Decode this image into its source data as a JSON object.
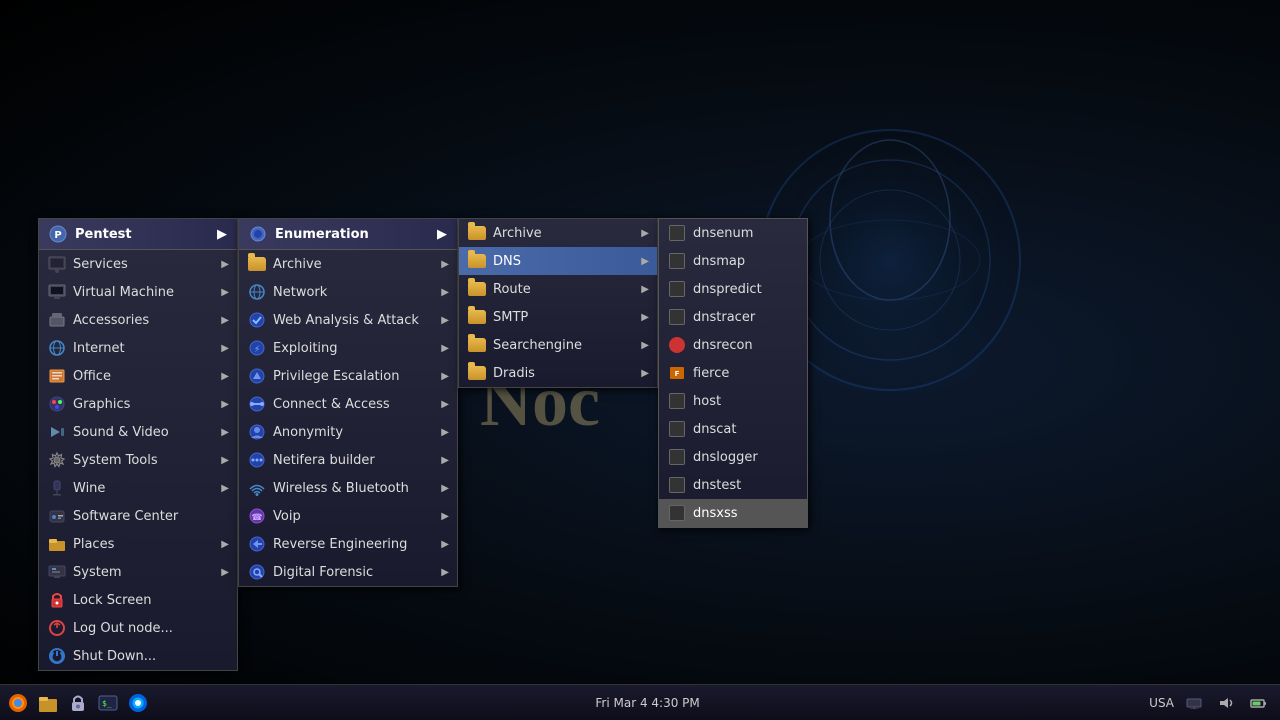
{
  "desktop": {
    "bg_text": "Noc"
  },
  "taskbar": {
    "datetime": "Fri Mar  4  4:30 PM",
    "locale": "USA",
    "icons": [
      "fire-icon",
      "folder-icon",
      "lock-icon",
      "browser-icon"
    ]
  },
  "menu_l1": {
    "header": "Pentest",
    "items": [
      {
        "label": "Services",
        "has_arrow": true
      },
      {
        "label": "Virtual Machine",
        "has_arrow": true
      },
      {
        "label": "Accessories",
        "has_arrow": true
      },
      {
        "label": "Internet",
        "has_arrow": true
      },
      {
        "label": "Office",
        "has_arrow": true
      },
      {
        "label": "Graphics",
        "has_arrow": true
      },
      {
        "label": "Sound & Video",
        "has_arrow": true
      },
      {
        "label": "System Tools",
        "has_arrow": true
      },
      {
        "label": "Wine",
        "has_arrow": true
      },
      {
        "label": "Software Center",
        "has_arrow": false
      },
      {
        "label": "Places",
        "has_arrow": true
      },
      {
        "label": "System",
        "has_arrow": true
      },
      {
        "label": "Lock Screen",
        "has_arrow": false
      },
      {
        "label": "Log Out node...",
        "has_arrow": false
      },
      {
        "label": "Shut Down...",
        "has_arrow": false
      }
    ]
  },
  "menu_l2": {
    "header": "Enumeration",
    "items": [
      {
        "label": "Archive",
        "has_arrow": true
      },
      {
        "label": "Network",
        "has_arrow": true
      },
      {
        "label": "Web Analysis & Attack",
        "has_arrow": true
      },
      {
        "label": "Exploiting",
        "has_arrow": true
      },
      {
        "label": "Privilege Escalation",
        "has_arrow": true
      },
      {
        "label": "Connect & Access",
        "has_arrow": true
      },
      {
        "label": "Anonymity",
        "has_arrow": true
      },
      {
        "label": "Netifera builder",
        "has_arrow": true
      },
      {
        "label": "Wireless & Bluetooth",
        "has_arrow": true
      },
      {
        "label": "Voip",
        "has_arrow": true
      },
      {
        "label": "Reverse Engineering",
        "has_arrow": true
      },
      {
        "label": "Digital Forensic",
        "has_arrow": true
      }
    ]
  },
  "menu_l3": {
    "items": [
      {
        "label": "Archive",
        "has_arrow": true
      },
      {
        "label": "DNS",
        "has_arrow": true,
        "active": true
      },
      {
        "label": "Route",
        "has_arrow": true
      },
      {
        "label": "SMTP",
        "has_arrow": true
      },
      {
        "label": "Searchengine",
        "has_arrow": true
      },
      {
        "label": "Dradis",
        "has_arrow": true
      }
    ]
  },
  "menu_l4": {
    "items": [
      {
        "label": "dnsenum"
      },
      {
        "label": "dnsmap"
      },
      {
        "label": "dnspredict"
      },
      {
        "label": "dnstracer"
      },
      {
        "label": "dnsrecon"
      },
      {
        "label": "fierce"
      },
      {
        "label": "host"
      },
      {
        "label": "dnscat"
      },
      {
        "label": "dnslogger"
      },
      {
        "label": "dnstest"
      },
      {
        "label": "dnsxss",
        "active": true
      }
    ]
  }
}
